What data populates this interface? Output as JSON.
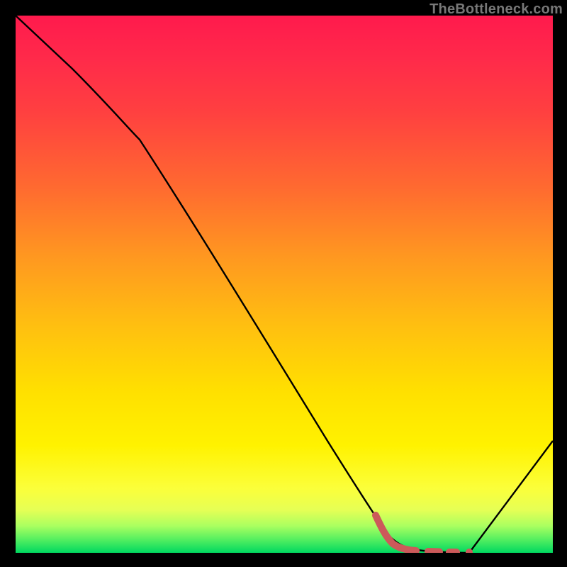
{
  "watermark": "TheBottleneck.com",
  "colors": {
    "background": "#000000",
    "curve": "#000000",
    "dash": "#cc5a5a",
    "gradient_top": "#ff1a4d",
    "gradient_bottom": "#00d860"
  },
  "chart_data": {
    "type": "line",
    "title": "",
    "xlabel": "",
    "ylabel": "",
    "xlim": [
      0,
      100
    ],
    "ylim": [
      0,
      100
    ],
    "grid": false,
    "legend": false,
    "series": [
      {
        "name": "bottleneck-curve",
        "x": [
          0,
          10,
          22,
          40,
          58,
          68,
          73,
          78,
          82,
          84,
          100
        ],
        "y": [
          100,
          90,
          78,
          48,
          19,
          4,
          1,
          0,
          0,
          0,
          21
        ]
      },
      {
        "name": "optimal-range-dash",
        "x": [
          67,
          70,
          72,
          74,
          76,
          78,
          80,
          82,
          84
        ],
        "y": [
          6,
          2,
          1,
          0.5,
          0.3,
          0.2,
          0.1,
          0,
          0
        ]
      }
    ],
    "note": "x and y are in percent of plot width/height; y=0 is bottom, y=100 is top"
  }
}
